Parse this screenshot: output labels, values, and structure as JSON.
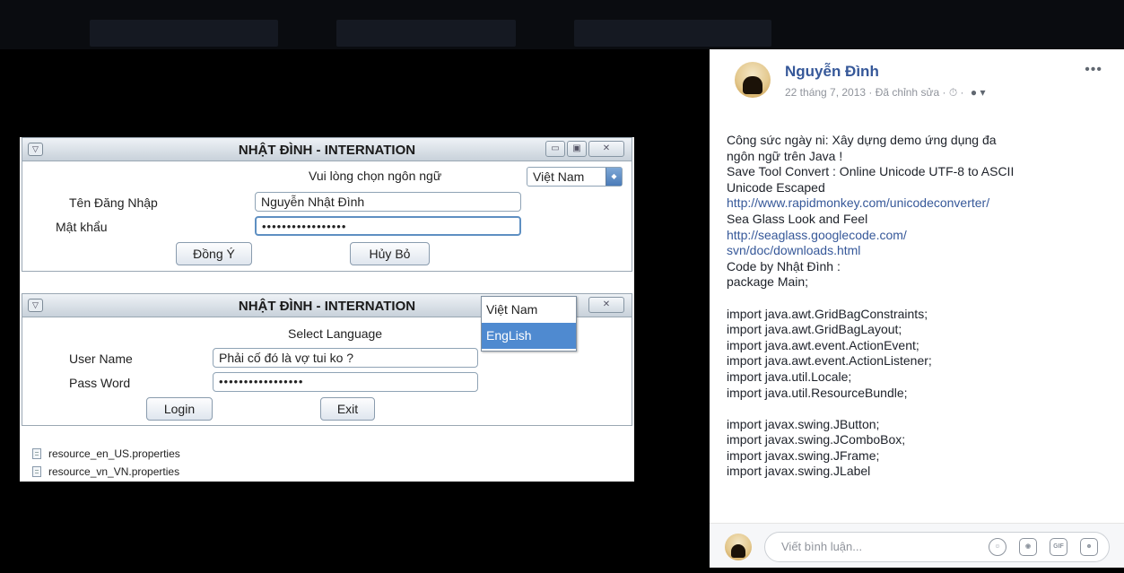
{
  "app_window_1": {
    "title": "NHẬT ĐÌNH - INTERNATION",
    "language_prompt": "Vui lòng chọn ngôn ngữ",
    "language_selected": "Việt Nam",
    "username_label": "Tên Đăng Nhập",
    "username_value": "Nguyễn Nhật Đình",
    "password_label": "Mật khẩu",
    "password_value": "•••••••••••••••••",
    "ok_button": "Đồng Ý",
    "cancel_button": "Hủy Bỏ"
  },
  "app_window_2": {
    "title": "NHẬT ĐÌNH - INTERNATION",
    "language_prompt": "Select Language",
    "dropdown_options": [
      "Việt Nam",
      "EngLish"
    ],
    "dropdown_selected_index": 1,
    "username_label": "User Name",
    "username_value": "Phải cố đó là vợ tui ko ?",
    "password_label": "Pass Word",
    "password_value": "•••••••••••••••••",
    "login_button": "Login",
    "exit_button": "Exit"
  },
  "files": [
    "resource_en_US.properties",
    "resource_vn_VN.properties"
  ],
  "post": {
    "author": "Nguyễn Đình",
    "timestamp": "22 tháng 7, 2013 · Đã chỉnh sửa · ⏱ ·",
    "more": "•••",
    "lines": [
      {
        "text": "Công sức ngày ni: Xây dựng demo ứng dụng đa",
        "link": false
      },
      {
        "text": "ngôn ngữ trên Java !",
        "link": false
      },
      {
        "text": "Save Tool Convert : Online Unicode UTF-8 to ASCII",
        "link": false
      },
      {
        "text": "Unicode Escaped",
        "link": false
      },
      {
        "text": "http://www.rapidmonkey.com/unicodeconverter/",
        "link": true
      },
      {
        "text": "Sea Glass Look and Feel",
        "link": false
      },
      {
        "text": "http://seaglass.googlecode.com/",
        "link": true
      },
      {
        "text": "svn/doc/downloads.html",
        "link": true
      },
      {
        "text": "Code by Nhật Đình :",
        "link": false
      },
      {
        "text": "package Main;",
        "link": false
      },
      {
        "text": "",
        "link": false
      },
      {
        "text": "import java.awt.GridBagConstraints;",
        "link": false
      },
      {
        "text": "import java.awt.GridBagLayout;",
        "link": false
      },
      {
        "text": "import java.awt.event.ActionEvent;",
        "link": false
      },
      {
        "text": "import java.awt.event.ActionListener;",
        "link": false
      },
      {
        "text": "import java.util.Locale;",
        "link": false
      },
      {
        "text": "import java.util.ResourceBundle;",
        "link": false
      },
      {
        "text": "",
        "link": false
      },
      {
        "text": "import javax.swing.JButton;",
        "link": false
      },
      {
        "text": "import javax.swing.JComboBox;",
        "link": false
      },
      {
        "text": "import javax.swing.JFrame;",
        "link": false
      },
      {
        "text": "import javax.swing.JLabel",
        "link": false
      }
    ],
    "comment_placeholder": "Viết bình luận...",
    "comment_icons": [
      "emoji-icon",
      "camera-icon",
      "gif-icon",
      "sticker-icon"
    ]
  }
}
